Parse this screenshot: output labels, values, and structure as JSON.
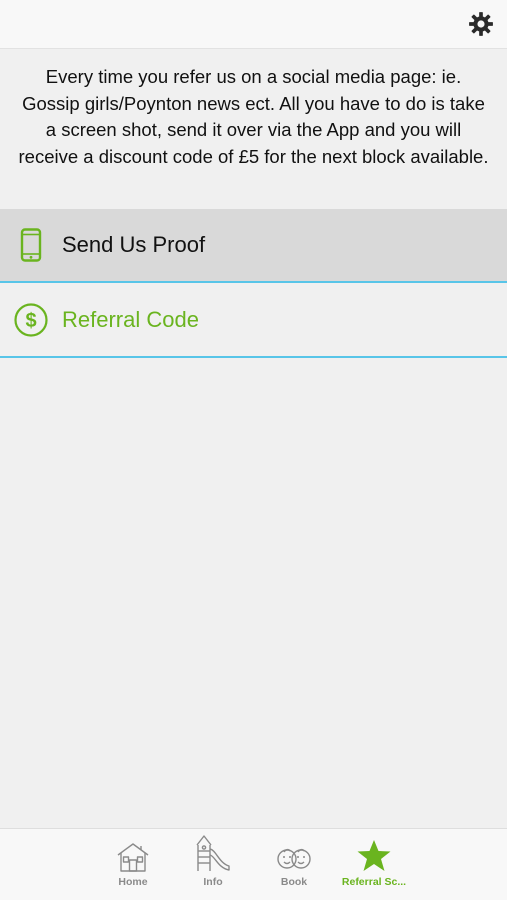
{
  "header": {
    "settings_icon": "gear-icon"
  },
  "intro": {
    "text": "Every time you refer us on a social media page: ie. Gossip girls/Poynton news ect. All you have to do is take a screen shot, send it over via the App and you will receive a discount code of £5 for the next block available."
  },
  "menu": [
    {
      "label": "Send Us Proof",
      "icon": "smartphone-icon"
    },
    {
      "label": "Referral Code",
      "icon": "dollar-circle-icon"
    }
  ],
  "tabbar": {
    "tabs": [
      {
        "label": "Home",
        "icon": "house-icon",
        "active": false
      },
      {
        "label": "Info",
        "icon": "playground-slide-icon",
        "active": false
      },
      {
        "label": "Book",
        "icon": "baby-faces-icon",
        "active": false
      },
      {
        "label": "Referral Sc...",
        "icon": "star-icon",
        "active": true
      }
    ]
  },
  "colors": {
    "accent_green": "#6ab41f",
    "divider_blue": "#58c5e8",
    "selected_row_bg": "#d9d9d9",
    "background": "#f0f0f0"
  }
}
